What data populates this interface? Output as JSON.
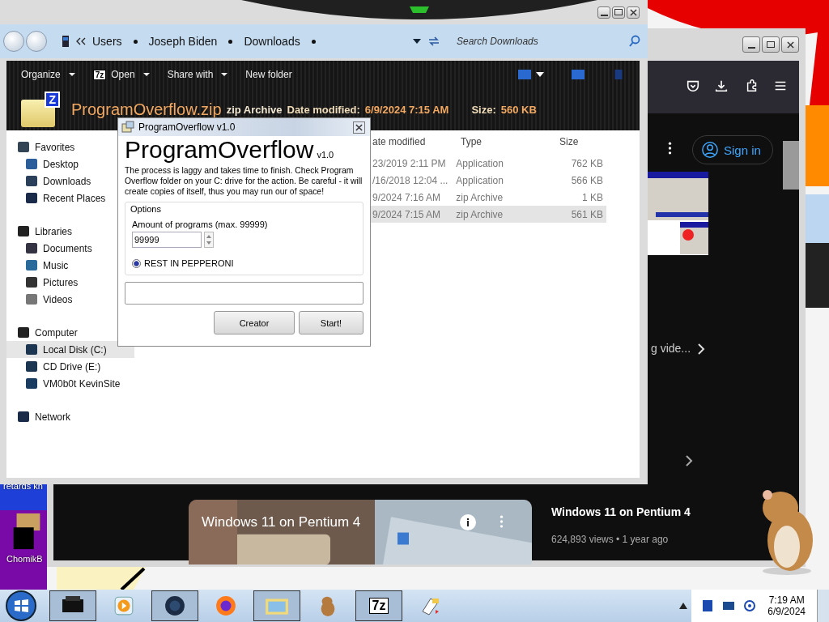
{
  "desktop": {
    "icons": [
      {
        "label": "retards kn"
      },
      {
        "label": "ChomikB"
      }
    ]
  },
  "browser": {
    "sign_in": "Sign in",
    "shelf_text": "g vide...",
    "video": {
      "title": "Windows 11 on Pentium 4"
    },
    "side": {
      "title": "Windows 11 on Pentium 4",
      "meta": "624,893 views • 1 year ago"
    }
  },
  "explorer": {
    "address": {
      "crumbs": [
        "Users",
        "Joseph Biden",
        "Downloads"
      ]
    },
    "search": {
      "placeholder": "Search Downloads"
    },
    "toolbar": [
      {
        "label": "Organize",
        "kind": "menu"
      },
      {
        "label": "Open",
        "kind": "menu",
        "icon_text": "7z"
      },
      {
        "label": "Share with",
        "kind": "menu"
      },
      {
        "label": "New folder",
        "kind": "plain"
      }
    ],
    "details": {
      "icon_text": "Z",
      "name": "ProgramOverflow.zip",
      "type": "zip Archive",
      "fields": [
        {
          "label": "Date modified:",
          "value": "6/9/2024 7:15 AM"
        },
        {
          "label": "Size:",
          "value": "560 KB"
        }
      ]
    },
    "nav": [
      {
        "label": "Favorites",
        "kind": "star",
        "selected": false,
        "children": [
          {
            "label": "Desktop",
            "kind": "desktop",
            "selected": false
          },
          {
            "label": "Downloads",
            "kind": "download",
            "selected": false
          },
          {
            "label": "Recent Places",
            "kind": "globe",
            "selected": false
          }
        ]
      },
      {
        "label": "Libraries",
        "kind": "library",
        "selected": false,
        "children": [
          {
            "label": "Documents",
            "kind": "doc",
            "selected": false
          },
          {
            "label": "Music",
            "kind": "music",
            "selected": false
          },
          {
            "label": "Pictures",
            "kind": "picture",
            "selected": false
          },
          {
            "label": "Videos",
            "kind": "video",
            "selected": false
          }
        ]
      },
      {
        "label": "Computer",
        "kind": "computer",
        "selected": false,
        "children": [
          {
            "label": "Local Disk (C:)",
            "kind": "disk",
            "selected": true
          },
          {
            "label": "CD Drive (E:)",
            "kind": "disk",
            "selected": false
          },
          {
            "label": "VM0b0t KevinSite",
            "kind": "share",
            "selected": false
          }
        ]
      },
      {
        "label": "Network",
        "kind": "globe",
        "selected": false
      }
    ],
    "columns": [
      "ate modified",
      "Type",
      "Size"
    ],
    "rows": [
      {
        "date": "23/2019 2:11 PM",
        "type": "Application",
        "size": "762 KB",
        "selected": false
      },
      {
        "date": "/16/2018 12:04 ...",
        "type": "Application",
        "size": "566 KB",
        "selected": false
      },
      {
        "date": "9/2024 7:16 AM",
        "type": "zip Archive",
        "size": "1 KB",
        "selected": false
      },
      {
        "date": "9/2024 7:15 AM",
        "type": "zip Archive",
        "size": "561 KB",
        "selected": true
      }
    ]
  },
  "dialog": {
    "title": "ProgramOverflow v1.0",
    "heading": "ProgramOverflow",
    "version": "v1.0",
    "description": "The process is laggy and takes time to finish. Check Program Overflow folder on your C: drive for the action. Be careful - it will create copies of itself, thus you may run our of space!",
    "group": "Options",
    "amount_label": "Amount of programs (max. 99999)",
    "amount_value": "99999",
    "radio": {
      "label": "REST IN PEPPERONI",
      "selected": true
    },
    "buttons": [
      "Creator",
      "Start!"
    ]
  },
  "taskbar": {
    "items": [
      {
        "kind": "printer"
      },
      {
        "kind": "media"
      },
      {
        "kind": "orb"
      },
      {
        "kind": "firefox"
      },
      {
        "kind": "explorer"
      },
      {
        "kind": "animal"
      },
      {
        "kind": "zip",
        "icon_text": "7z"
      },
      {
        "kind": "paper"
      }
    ],
    "time": "7:19 AM",
    "date": "6/9/2024"
  }
}
